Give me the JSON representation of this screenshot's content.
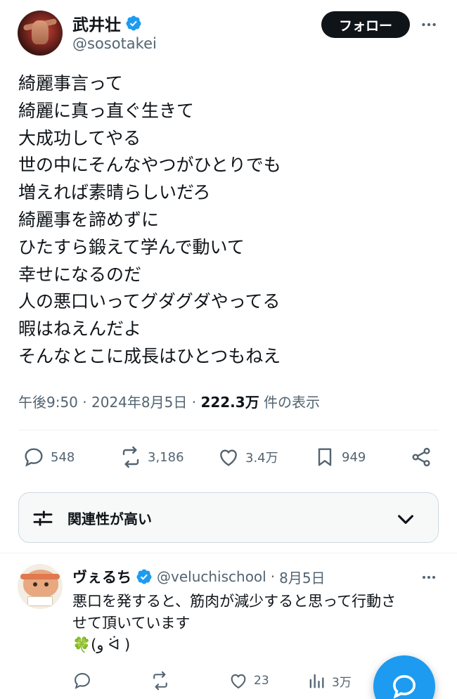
{
  "post": {
    "author_name": "武井壮",
    "handle": "@sosotakei",
    "follow_label": "フォロー",
    "lines": [
      "綺麗事言って",
      "綺麗に真っ直ぐ生きて",
      "大成功してやる",
      "世の中にそんなやつがひとりでも",
      "増えれば素晴らしいだろ",
      "綺麗事を諦めずに",
      "ひたすら鍛えて学んで動いて",
      "幸せになるのだ",
      "人の悪口いってグダグダやってる",
      "暇はねえんだよ",
      "そんなとこに成長はひとつもねえ"
    ],
    "time": "午後9:50",
    "sep1": " · ",
    "date": "2024年8月5日",
    "sep2": " · ",
    "views": "222.3万",
    "views_suffix": " 件の表示",
    "stats": {
      "replies": "548",
      "reposts": "3,186",
      "likes": "3.4万",
      "bookmarks": "949"
    }
  },
  "relevance_filter": {
    "label": "関連性が高い"
  },
  "reply": {
    "author_name": "ヴぇるち",
    "handle": "@veluchischool",
    "sep": " · ",
    "date": "8月5日",
    "lines": [
      "悪口を発すると、筋肉が減少すると思って行動さ",
      "せて頂いています",
      "🍀(و ᐛ )"
    ],
    "stats": {
      "replies": "",
      "reposts": "",
      "likes": "23",
      "views": "3万"
    }
  },
  "colors": {
    "verified_blue": "#1d9bf0",
    "text_primary": "#0f1419",
    "text_secondary": "#536471",
    "fab_blue": "#1d9bf0"
  },
  "icons": [
    "verified-badge-icon",
    "more-icon",
    "reply-icon",
    "repost-icon",
    "like-icon",
    "bookmark-icon",
    "share-icon",
    "sliders-icon",
    "chevron-down-icon",
    "views-icon",
    "compose-reply-icon"
  ]
}
